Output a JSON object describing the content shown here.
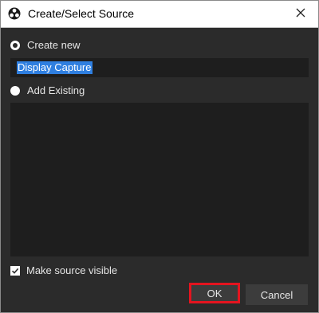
{
  "window": {
    "title": "Create/Select Source",
    "icon": "obs-logo-icon",
    "close_icon": "close-icon"
  },
  "create_new": {
    "label": "Create new",
    "selected": true,
    "input_value": "Display Capture"
  },
  "add_existing": {
    "label": "Add Existing",
    "selected": false,
    "items": []
  },
  "visible_toggle": {
    "label": "Make source visible",
    "checked": true
  },
  "buttons": {
    "ok_label": "OK",
    "cancel_label": "Cancel"
  },
  "colors": {
    "dialog_bg": "#2b2b2b",
    "field_bg": "#1e1e1e",
    "selection": "#2f7fe0",
    "highlight_border": "#e4141f"
  }
}
